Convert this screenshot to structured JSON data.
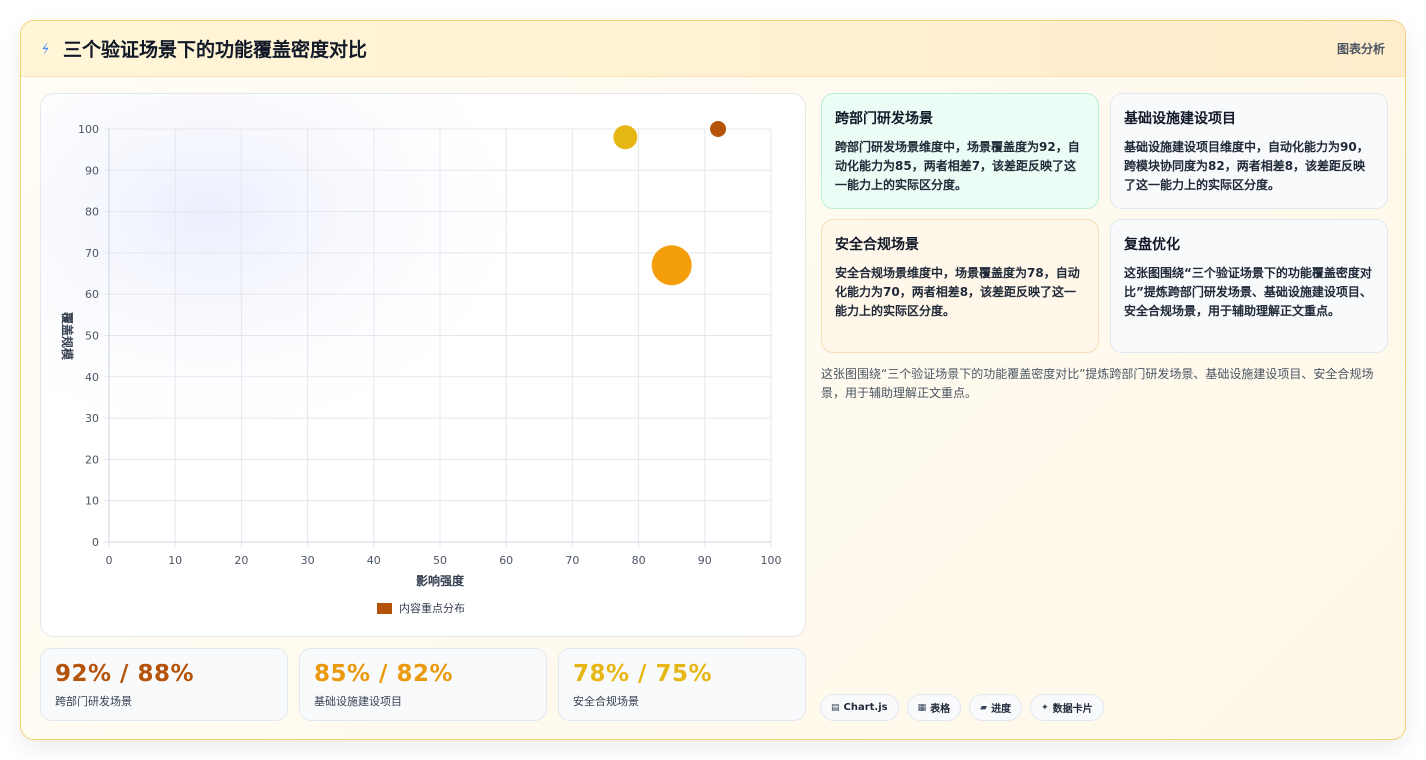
{
  "header": {
    "icon": "lightning-icon",
    "title": "三个验证场景下的功能覆盖密度对比",
    "tag": "图表分析"
  },
  "chart_data": {
    "type": "scatter",
    "xlabel": "影响强度",
    "ylabel": "覆盖规模",
    "xlim": [
      0,
      100
    ],
    "ylim": [
      0,
      100
    ],
    "xticks": [
      "0",
      "10",
      "20",
      "30",
      "40",
      "50",
      "60",
      "70",
      "80",
      "90",
      "100"
    ],
    "yticks": [
      "0",
      "10",
      "20",
      "30",
      "40",
      "50",
      "60",
      "70",
      "80",
      "90",
      "100"
    ],
    "grid": true,
    "legend_position": "bottom",
    "series": [
      {
        "name": "内容重点分布",
        "points": [
          {
            "x": 78,
            "y": 98,
            "size": 12,
            "color": "#e6b714"
          },
          {
            "x": 92,
            "y": 100,
            "size": 8,
            "color": "#b45309"
          },
          {
            "x": 85,
            "y": 67,
            "size": 20,
            "color": "#f59e0b"
          }
        ]
      }
    ],
    "legend_color": "#b45309"
  },
  "stats": [
    {
      "value": "92% / 88%",
      "label": "跨部门研发场景",
      "color": "#b45309"
    },
    {
      "value": "85% / 82%",
      "label": "基础设施建设项目",
      "color": "#ea9a0c"
    },
    {
      "value": "78% / 75%",
      "label": "安全合规场景",
      "color": "#e6b714"
    }
  ],
  "cards": [
    {
      "title": "跨部门研发场景",
      "text": "跨部门研发场景维度中，场景覆盖度为92，自动化能力为85，两者相差7，该差距反映了这一能力上的实际区分度。"
    },
    {
      "title": "基础设施建设项目",
      "text": "基础设施建设项目维度中，自动化能力为90，跨模块协同度为82，两者相差8，该差距反映了这一能力上的实际区分度。"
    },
    {
      "title": "安全合规场景",
      "text": "安全合规场景维度中，场景覆盖度为78，自动化能力为70，两者相差8，该差距反映了这一能力上的实际区分度。"
    },
    {
      "title": "复盘优化",
      "text": "这张图围绕“三个验证场景下的功能覆盖密度对比”提炼跨部门研发场景、基础设施建设项目、安全合规场景，用于辅助理解正文重点。"
    }
  ],
  "summary": "这张图围绕“三个验证场景下的功能覆盖密度对比”提炼跨部门研发场景、基础设施建设项目、安全合规场景，用于辅助理解正文重点。",
  "chips": [
    {
      "icon": "chart-icon",
      "label": "Chart.js"
    },
    {
      "icon": "table-icon",
      "label": "表格"
    },
    {
      "icon": "progress-icon",
      "label": "进度"
    },
    {
      "icon": "sparkle-icon",
      "label": "数据卡片"
    }
  ]
}
